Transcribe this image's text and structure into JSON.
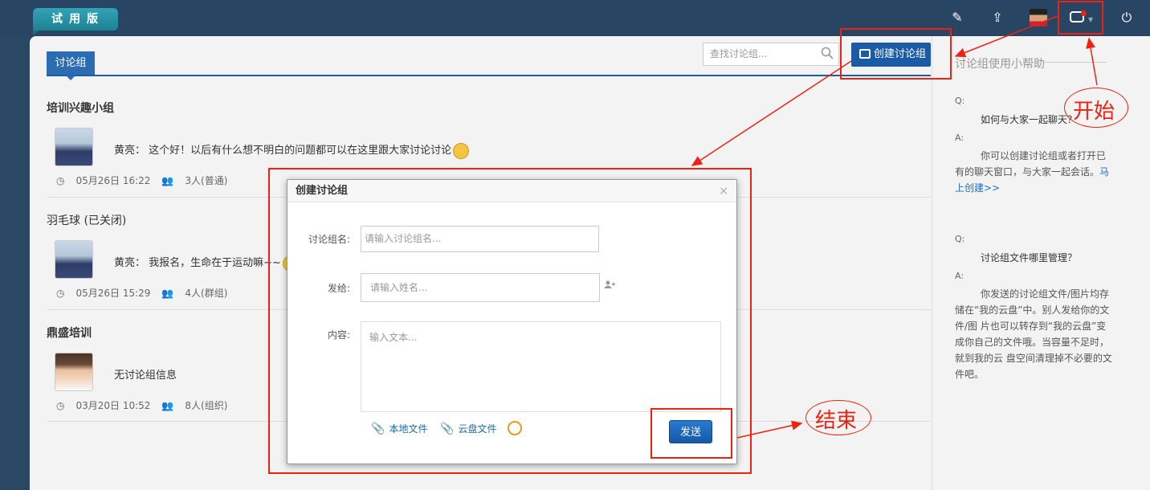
{
  "topbar": {
    "trial_label": "试用版",
    "icons": [
      "edit-icon",
      "upload-icon",
      "avatar",
      "message-icon",
      "power-icon"
    ]
  },
  "tabs": [
    {
      "label": "讨论组"
    }
  ],
  "search": {
    "placeholder": "查找讨论组..."
  },
  "create_button": {
    "label": "创建讨论组"
  },
  "groups": [
    {
      "title": "培训兴趣小组",
      "sender": "黄亮：",
      "message": "这个好！以后有什么想不明白的问题都可以在这里跟大家讨论讨论",
      "time": "05月26日 16:22",
      "members": "3人(普通)"
    },
    {
      "title": "羽毛球 (已关闭)",
      "sender": "黄亮：",
      "message": "我报名，生命在于运动嘛~~",
      "time": "05月26日 15:29",
      "members": "4人(群组)"
    },
    {
      "title": "鼎盛培训",
      "sender": "",
      "message": "无讨论组信息",
      "time": "03月20日 10:52",
      "members": "8人(组织)"
    }
  ],
  "help": {
    "title": "讨论组使用小帮助",
    "q_label": "Q:",
    "a_label": "A:",
    "q1": "如何与大家一起聊天？",
    "a1": "你可以创建讨论组或者打开已有的聊天窗口，与大家一起会话。",
    "a1_link": "马上创建>>",
    "q2": "讨论组文件哪里管理？",
    "a2": "你发送的讨论组文件/图片均存储在“我的云盘”中。别人发给你的文件/图 片也可以转存到“我的云盘”变成你自己的文件哦。当容量不足时，就到我的云 盘空间清理掉不必要的文件吧。"
  },
  "dialog": {
    "title": "创建讨论组",
    "close": "×",
    "name_label": "讨论组名:",
    "name_placeholder": "请输入讨论组名...",
    "to_label": "发给:",
    "to_placeholder": "请输入姓名...",
    "content_label": "内容:",
    "content_placeholder": "输入文本...",
    "local_file": "本地文件",
    "cloud_file": "云盘文件",
    "send": "发送"
  },
  "annotations": {
    "start": "开始",
    "end": "结束"
  },
  "colors": {
    "primary": "#1a5aa6",
    "annotation": "#e21e1e",
    "topbar": "#284563"
  }
}
